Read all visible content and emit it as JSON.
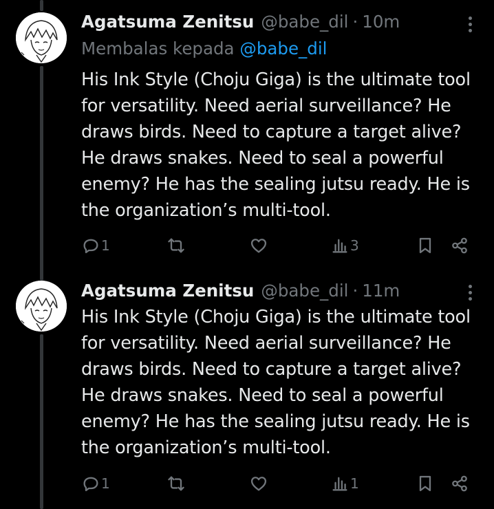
{
  "tweets": [
    {
      "author_name": "Agatsuma Zenitsu",
      "handle": "@babe_dil",
      "separator": "·",
      "time": "10m",
      "reply_prefix": "Membalas kepada",
      "reply_to": "@babe_dil",
      "text_lines": [
        "His Ink Style (Choju Giga) is the ultimate tool",
        "for versatility. Need aerial surveillance? He",
        "draws birds. Need to capture a target alive?",
        "He draws snakes. Need to seal a powerful",
        "enemy? He has the sealing jutsu ready. He is",
        "the organization’s multi-tool."
      ],
      "reply_count": "1",
      "views_count": "3"
    },
    {
      "author_name": "Agatsuma Zenitsu",
      "handle": "@babe_dil",
      "separator": "·",
      "time": "11m",
      "text_lines": [
        "His Ink Style (Choju Giga) is the ultimate tool",
        "for versatility. Need aerial surveillance? He",
        "draws birds. Need to capture a target alive?",
        "He draws snakes. Need to seal a powerful",
        "enemy? He has the sealing jutsu ready. He is",
        "the organization’s multi-tool."
      ],
      "reply_count": "1",
      "views_count": "1"
    }
  ],
  "icons": [
    "reply-icon",
    "retweet-icon",
    "like-icon",
    "views-icon",
    "bookmark-icon",
    "share-icon",
    "more-icon"
  ],
  "colors": {
    "background": "#000000",
    "text": "#e7e9ea",
    "muted": "#71767b",
    "link": "#1d9bf0",
    "thread_line": "#333639"
  }
}
